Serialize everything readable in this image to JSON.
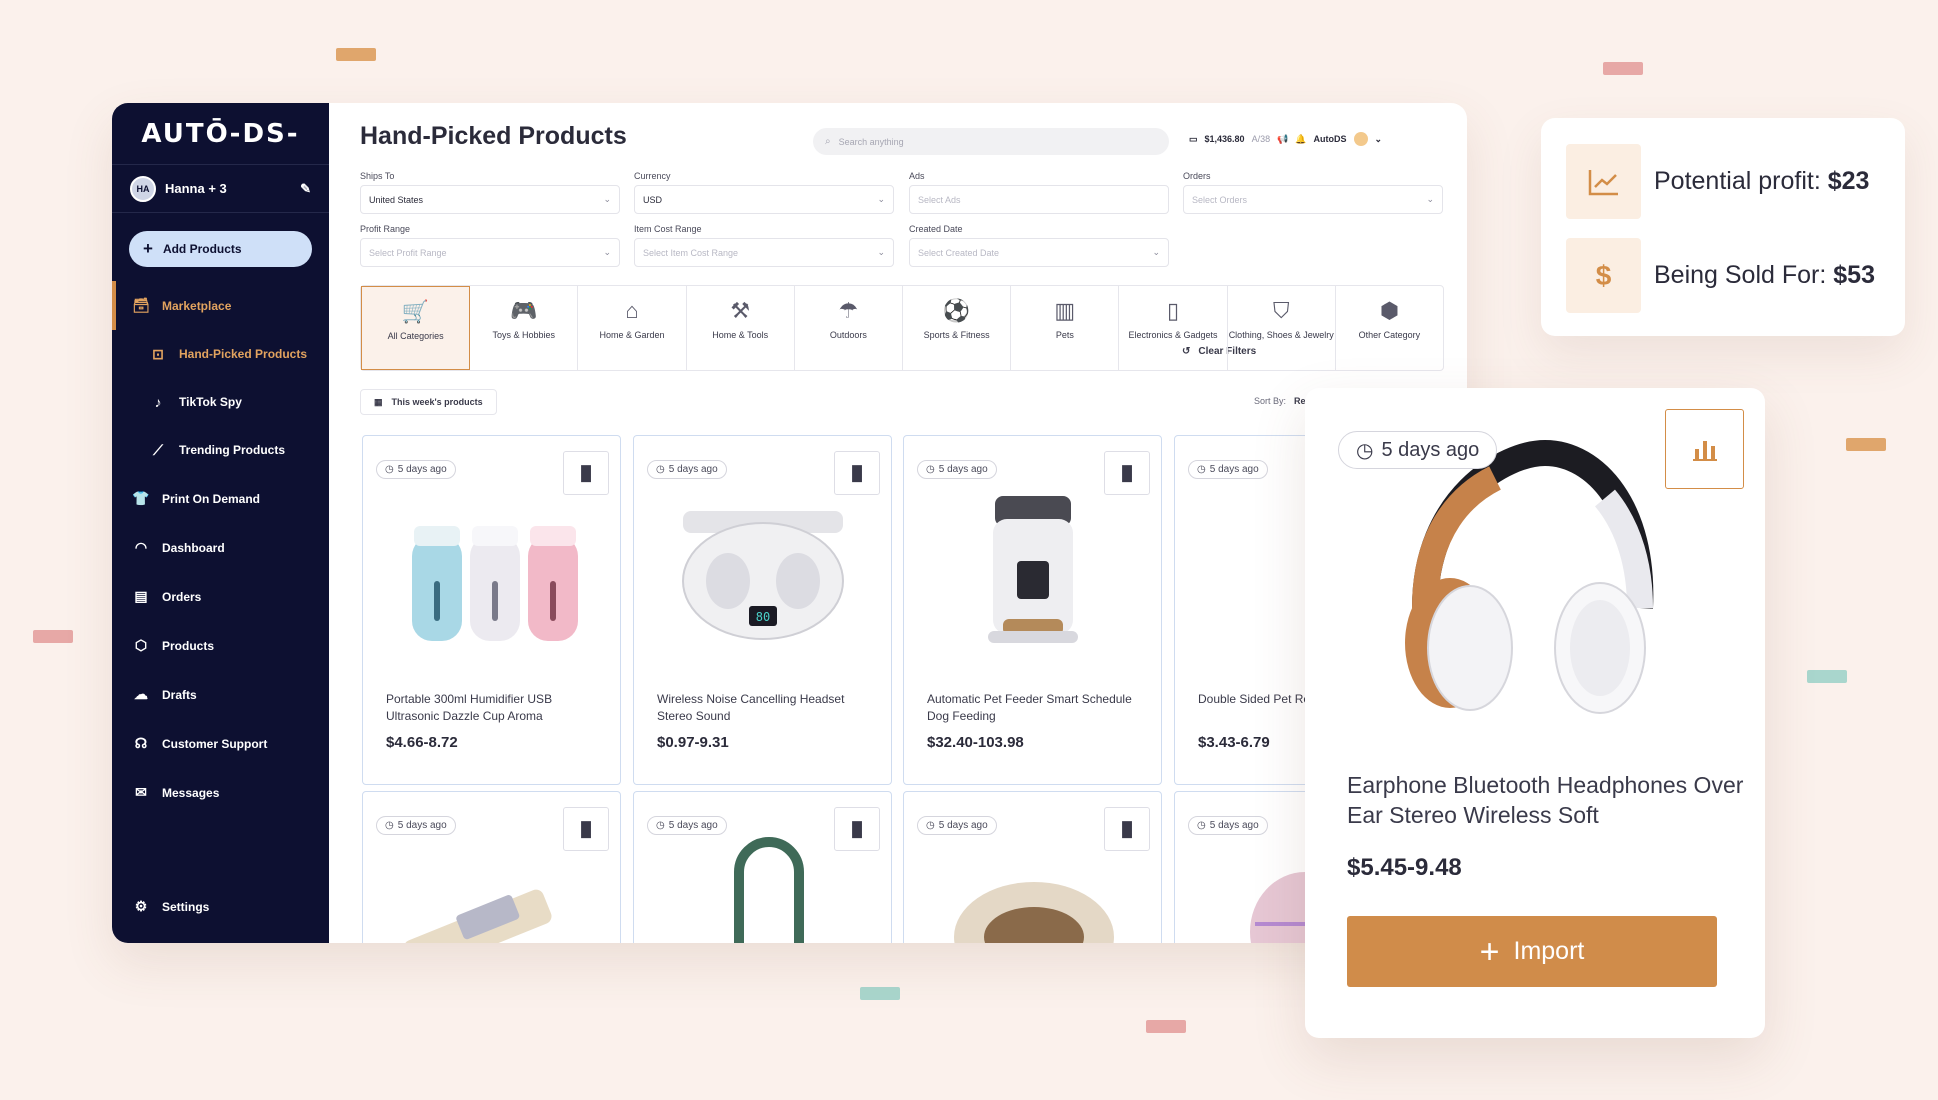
{
  "brand": {
    "logo_text": "AUTŌ-DS-",
    "accent": "#d38d47",
    "sidebar_bg": "#0d1031"
  },
  "user": {
    "initials": "HA",
    "name": "Hanna + 3"
  },
  "sidebar": {
    "add_button": "Add Products",
    "items": [
      {
        "label": "Marketplace",
        "icon": "store-icon"
      },
      {
        "label": "Hand-Picked Products",
        "icon": "gift-icon"
      },
      {
        "label": "TikTok Spy",
        "icon": "tiktok-icon"
      },
      {
        "label": "Trending Products",
        "icon": "trend-icon"
      },
      {
        "label": "Print On Demand",
        "icon": "shirt-icon"
      },
      {
        "label": "Dashboard",
        "icon": "gauge-icon"
      },
      {
        "label": "Orders",
        "icon": "receipt-icon"
      },
      {
        "label": "Products",
        "icon": "box-icon"
      },
      {
        "label": "Drafts",
        "icon": "cloud-icon"
      },
      {
        "label": "Customer Support",
        "icon": "headset-icon"
      },
      {
        "label": "Messages",
        "icon": "mail-icon"
      }
    ],
    "settings": "Settings"
  },
  "header": {
    "title": "Hand-Picked Products",
    "search_placeholder": "Search anything",
    "balance": "$1,436.80",
    "balance_sub": "A/38",
    "account": "AutoDS"
  },
  "filters": {
    "ships_to": {
      "label": "Ships To",
      "value": "United States"
    },
    "currency": {
      "label": "Currency",
      "value": "USD"
    },
    "ads": {
      "label": "Ads",
      "placeholder": "Select Ads"
    },
    "orders": {
      "label": "Orders",
      "placeholder": "Select Orders"
    },
    "profit_range": {
      "label": "Profit Range",
      "placeholder": "Select Profit Range"
    },
    "item_cost_range": {
      "label": "Item Cost Range",
      "placeholder": "Select Item Cost Range"
    },
    "created_date": {
      "label": "Created Date",
      "placeholder": "Select Created Date"
    },
    "clear": "Clear Filters"
  },
  "categories": [
    {
      "label": "All Categories",
      "icon": "cart-icon"
    },
    {
      "label": "Toys & Hobbies",
      "icon": "gamepad-icon"
    },
    {
      "label": "Home & Garden",
      "icon": "house-icon"
    },
    {
      "label": "Home & Tools",
      "icon": "tools-icon"
    },
    {
      "label": "Outdoors",
      "icon": "umbrella-icon"
    },
    {
      "label": "Sports & Fitness",
      "icon": "ball-icon"
    },
    {
      "label": "Pets",
      "icon": "pet-food-icon"
    },
    {
      "label": "Electronics & Gadgets",
      "icon": "phone-icon"
    },
    {
      "label": "Clothing, Shoes & Jewelry",
      "icon": "bag-icon"
    },
    {
      "label": "Other Category",
      "icon": "package-icon"
    }
  ],
  "toolbar": {
    "weekly": "This week's products",
    "sort_label": "Sort By:",
    "sort_value": "Rec"
  },
  "products": [
    {
      "age": "5 days ago",
      "title": "Portable 300ml Humidifier USB Ultrasonic Dazzle Cup Aroma",
      "price": "$4.66-8.72"
    },
    {
      "age": "5 days ago",
      "title": "Wireless Noise Cancelling Headset Stereo Sound",
      "price": "$0.97-9.31"
    },
    {
      "age": "5 days ago",
      "title": "Automatic Pet Feeder Smart Schedule Dog Feeding",
      "price": "$32.40-103.98"
    },
    {
      "age": "5 days ago",
      "title": "Double Sided Pet Removal Comb Lo",
      "price": "$3.43-6.79"
    },
    {
      "age": "5 days ago"
    },
    {
      "age": "5 days ago"
    },
    {
      "age": "5 days ago"
    },
    {
      "age": "5 days ago"
    }
  ],
  "profit_card": {
    "potential_label": "Potential profit:",
    "potential_value": "$23",
    "sold_label": "Being Sold For:",
    "sold_value": "$53"
  },
  "detail": {
    "age": "5 days ago",
    "title": "Earphone Bluetooth Headphones Over Ear Stereo Wireless Soft",
    "price": "$5.45-9.48",
    "import": "Import"
  }
}
